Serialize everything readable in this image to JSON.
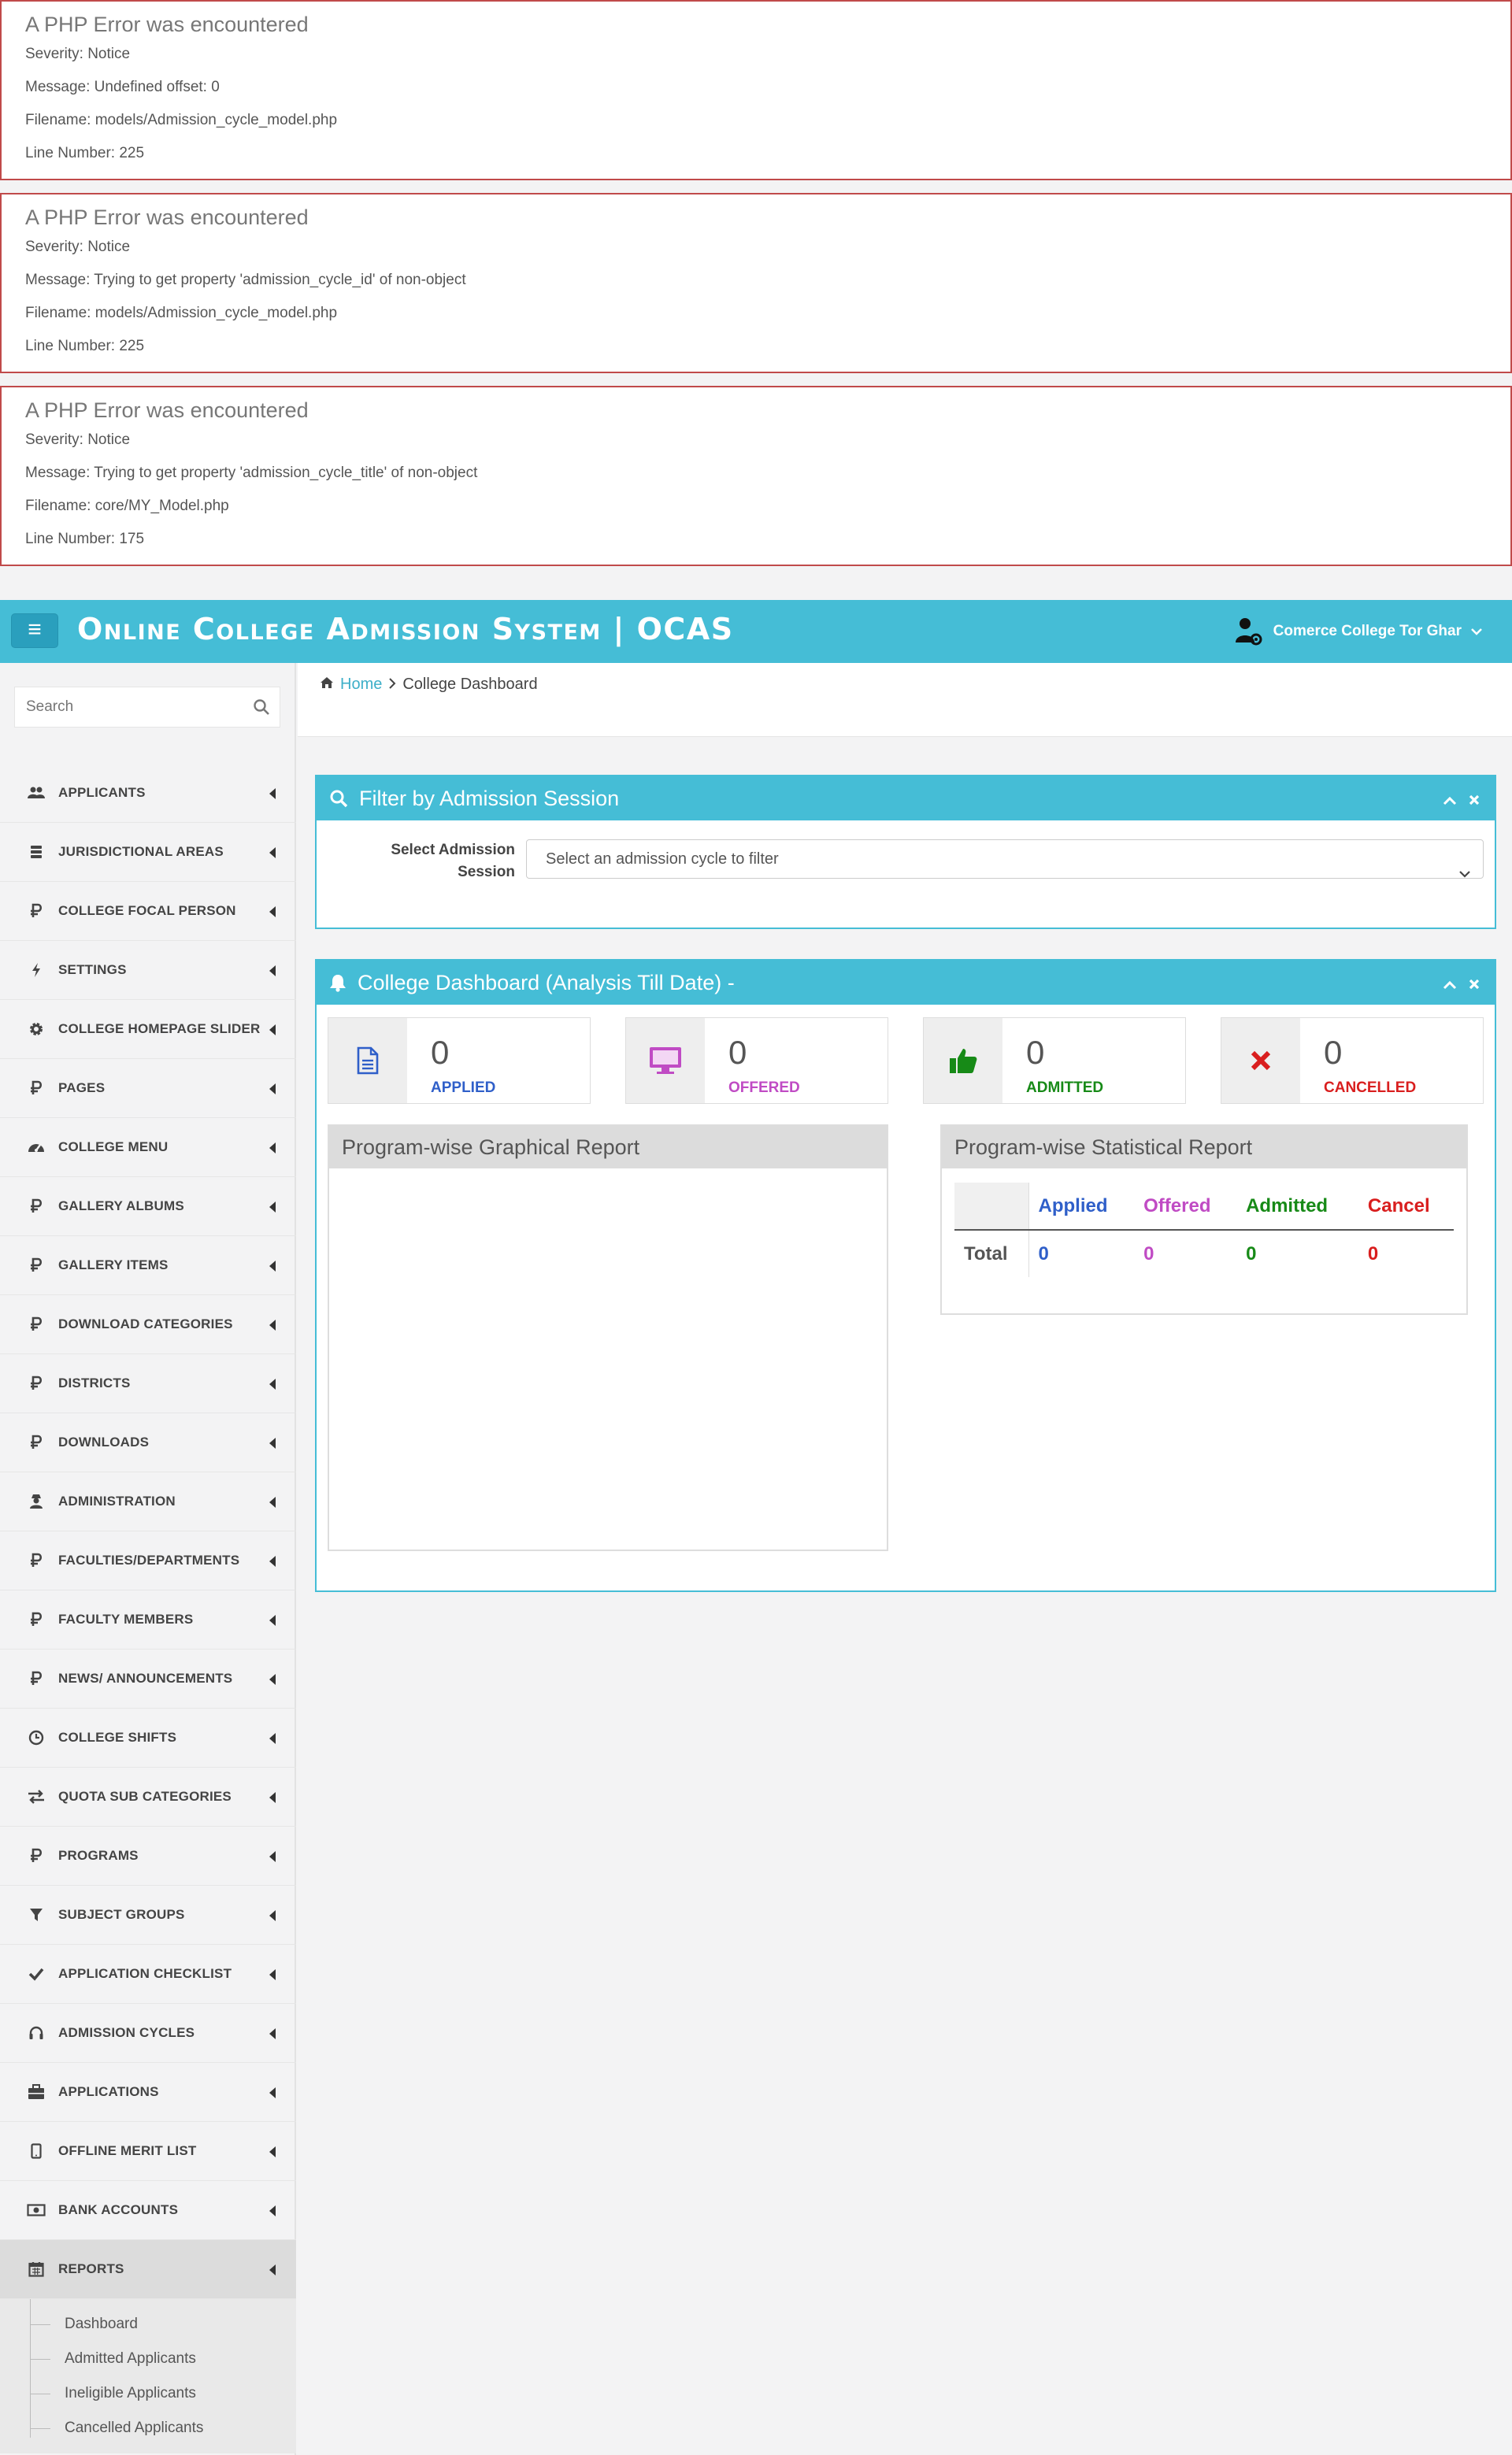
{
  "errors": [
    {
      "title": "A PHP Error was encountered",
      "severity": "Severity: Notice",
      "message": "Message: Undefined offset: 0",
      "filename": "Filename: models/Admission_cycle_model.php",
      "line": "Line Number: 225"
    },
    {
      "title": "A PHP Error was encountered",
      "severity": "Severity: Notice",
      "message": "Message: Trying to get property 'admission_cycle_id' of non-object",
      "filename": "Filename: models/Admission_cycle_model.php",
      "line": "Line Number: 225"
    },
    {
      "title": "A PHP Error was encountered",
      "severity": "Severity: Notice",
      "message": "Message: Trying to get property 'admission_cycle_title' of non-object",
      "filename": "Filename: core/MY_Model.php",
      "line": "Line Number: 175"
    }
  ],
  "navbar": {
    "toggle_label": "≡",
    "brand": "Online College Admission System | OCAS",
    "user_name": "Comerce College Tor Ghar"
  },
  "sidebar": {
    "search_placeholder": "Search",
    "items": [
      {
        "label": "APPLICANTS",
        "icon": "users-icon"
      },
      {
        "label": "JURISDICTIONAL AREAS",
        "icon": "database-icon"
      },
      {
        "label": "COLLEGE FOCAL PERSON",
        "icon": "ruble-icon"
      },
      {
        "label": "SETTINGS",
        "icon": "bolt-icon"
      },
      {
        "label": "COLLEGE HOMEPAGE SLIDER",
        "icon": "cog-icon"
      },
      {
        "label": "PAGES",
        "icon": "ruble-icon"
      },
      {
        "label": "COLLEGE MENU",
        "icon": "dashboard-icon"
      },
      {
        "label": "GALLERY ALBUMS",
        "icon": "ruble-icon"
      },
      {
        "label": "GALLERY ITEMS",
        "icon": "ruble-icon"
      },
      {
        "label": "DOWNLOAD CATEGORIES",
        "icon": "ruble-icon"
      },
      {
        "label": "DISTRICTS",
        "icon": "ruble-icon"
      },
      {
        "label": "DOWNLOADS",
        "icon": "ruble-icon"
      },
      {
        "label": "ADMINISTRATION",
        "icon": "user-secret-icon"
      },
      {
        "label": "FACULTIES/DEPARTMENTS",
        "icon": "ruble-icon"
      },
      {
        "label": "FACULTY MEMBERS",
        "icon": "ruble-icon"
      },
      {
        "label": "NEWS/ ANNOUNCEMENTS",
        "icon": "ruble-icon"
      },
      {
        "label": "COLLEGE SHIFTS",
        "icon": "clock-icon"
      },
      {
        "label": "QUOTA SUB CATEGORIES",
        "icon": "exchange-icon"
      },
      {
        "label": "PROGRAMS",
        "icon": "ruble-icon"
      },
      {
        "label": "SUBJECT GROUPS",
        "icon": "filter-icon"
      },
      {
        "label": "APPLICATION CHECKLIST",
        "icon": "check-icon"
      },
      {
        "label": "ADMISSION CYCLES",
        "icon": "headphones-icon"
      },
      {
        "label": "APPLICATIONS",
        "icon": "briefcase-icon"
      },
      {
        "label": "OFFLINE MERIT LIST",
        "icon": "tablet-icon"
      },
      {
        "label": "BANK ACCOUNTS",
        "icon": "money-icon"
      },
      {
        "label": "REPORTS",
        "icon": "calendar-icon"
      }
    ],
    "reports_sub": [
      "Dashboard",
      "Admitted Applicants",
      "Ineligible Applicants",
      "Cancelled Applicants"
    ]
  },
  "breadcrumb": {
    "home": "Home",
    "current": "College Dashboard"
  },
  "filter_panel": {
    "title": "Filter by Admission Session",
    "label": "Select Admission Session",
    "select_value": "Select an admission cycle to filter"
  },
  "dashboard_panel": {
    "title": "College Dashboard (Analysis Till Date) -",
    "stats": [
      {
        "value": "0",
        "label": "APPLIED",
        "color": "#2f5fc9",
        "icon": "file-icon"
      },
      {
        "value": "0",
        "label": "OFFERED",
        "color": "#c04bc4",
        "icon": "desktop-icon"
      },
      {
        "value": "0",
        "label": "ADMITTED",
        "color": "#178a17",
        "icon": "thumbs-up-icon"
      },
      {
        "value": "0",
        "label": "CANCELLED",
        "color": "#d91e1e",
        "icon": "times-icon"
      }
    ],
    "graphical_title": "Program-wise Graphical Report",
    "statistical_title": "Program-wise Statistical Report",
    "table": {
      "headers": [
        "Applied",
        "Offered",
        "Admitted",
        "Cancel"
      ],
      "row_label": "Total",
      "row_values": [
        "0",
        "0",
        "0",
        "0"
      ]
    }
  },
  "colors": {
    "accent": "#45bdd6",
    "error_border": "#c04a4a"
  }
}
